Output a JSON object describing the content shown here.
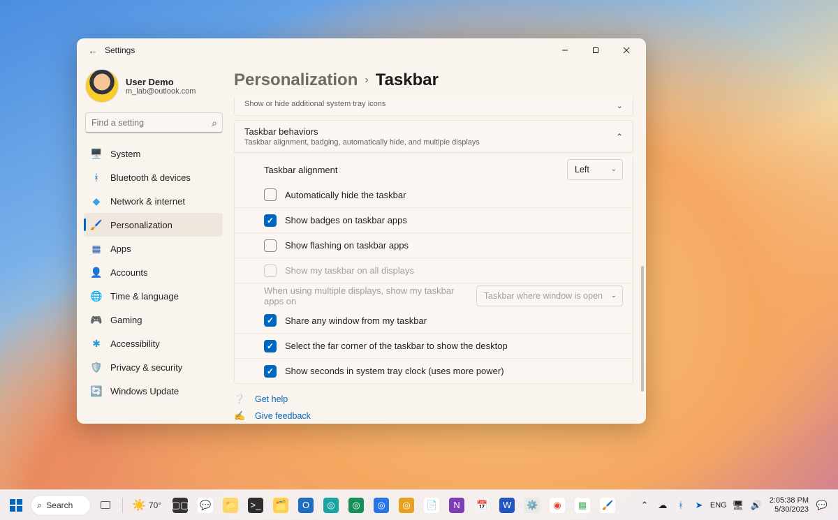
{
  "window": {
    "title": "Settings",
    "back_aria": "Back"
  },
  "user": {
    "name": "User Demo",
    "email": "m_lab@outlook.com"
  },
  "search": {
    "placeholder": "Find a setting"
  },
  "nav": [
    {
      "icon": "🖥️",
      "label": "System"
    },
    {
      "icon": "ᚼ",
      "iconColor": "#0067c0",
      "label": "Bluetooth & devices"
    },
    {
      "icon": "◆",
      "iconColor": "#3aa0e6",
      "label": "Network & internet"
    },
    {
      "icon": "🖌️",
      "label": "Personalization",
      "selected": true
    },
    {
      "icon": "▦",
      "iconColor": "#2a5db0",
      "label": "Apps"
    },
    {
      "icon": "👤",
      "iconColor": "#3fae6d",
      "label": "Accounts"
    },
    {
      "icon": "🌐",
      "iconColor": "#2a9ed6",
      "label": "Time & language"
    },
    {
      "icon": "🎮",
      "label": "Gaming"
    },
    {
      "icon": "✱",
      "iconColor": "#2a9ed6",
      "label": "Accessibility"
    },
    {
      "icon": "🛡️",
      "label": "Privacy & security"
    },
    {
      "icon": "🔄",
      "iconColor": "#2a9ed6",
      "label": "Windows Update"
    }
  ],
  "breadcrumb": {
    "parent": "Personalization",
    "current": "Taskbar"
  },
  "prev_section_sub": "Show or hide additional system tray icons",
  "section": {
    "title": "Taskbar behaviors",
    "subtitle": "Taskbar alignment, badging, automatically hide, and multiple displays"
  },
  "alignment": {
    "label": "Taskbar alignment",
    "value": "Left"
  },
  "options": [
    {
      "label": "Automatically hide the taskbar",
      "checked": false
    },
    {
      "label": "Show badges on taskbar apps",
      "checked": true
    },
    {
      "label": "Show flashing on taskbar apps",
      "checked": false
    },
    {
      "label": "Show my taskbar on all displays",
      "checked": false,
      "disabled": true
    }
  ],
  "multi": {
    "label": "When using multiple displays, show my taskbar apps on",
    "value": "Taskbar where window is open",
    "disabled": true
  },
  "options2": [
    {
      "label": "Share any window from my taskbar",
      "checked": true
    },
    {
      "label": "Select the far corner of the taskbar to show the desktop",
      "checked": true
    },
    {
      "label": "Show seconds in system tray clock (uses more power)",
      "checked": true
    }
  ],
  "help": {
    "get_help": "Get help",
    "give_feedback": "Give feedback"
  },
  "taskbar": {
    "search": "Search",
    "weather": "70°",
    "apps": [
      {
        "name": "task-view",
        "bg": "#333",
        "glyph": "▢▢",
        "color": "#fff"
      },
      {
        "name": "chat",
        "bg": "#fff",
        "glyph": "💬",
        "color": "#6b5ae0"
      },
      {
        "name": "explorer",
        "bg": "#ffd56b",
        "glyph": "📁"
      },
      {
        "name": "terminal",
        "bg": "#2d2d2d",
        "glyph": ">_",
        "color": "#fff"
      },
      {
        "name": "file-explorer",
        "bg": "#ffcf4d",
        "glyph": "🗂️"
      },
      {
        "name": "outlook",
        "bg": "#1f6dc0",
        "glyph": "O",
        "color": "#fff"
      },
      {
        "name": "edge",
        "bg": "#1aa3a3",
        "glyph": "◎",
        "color": "#fff"
      },
      {
        "name": "edge-dev",
        "bg": "#188f58",
        "glyph": "◎",
        "color": "#fff"
      },
      {
        "name": "edge-beta",
        "bg": "#2876e6",
        "glyph": "◎",
        "color": "#fff"
      },
      {
        "name": "edge-canary",
        "bg": "#e6a21f",
        "glyph": "◎",
        "color": "#fff"
      },
      {
        "name": "notepad",
        "bg": "#fff",
        "glyph": "📄"
      },
      {
        "name": "onenote",
        "bg": "#7d3db6",
        "glyph": "N",
        "color": "#fff"
      },
      {
        "name": "calendar",
        "bg": "#f3f3f3",
        "glyph": "📅"
      },
      {
        "name": "word",
        "bg": "#2156c0",
        "glyph": "W",
        "color": "#fff"
      },
      {
        "name": "settings",
        "bg": "#e8e8e8",
        "glyph": "⚙️"
      },
      {
        "name": "chrome",
        "bg": "#fff",
        "glyph": "◉",
        "color": "#e34133"
      },
      {
        "name": "app-grid",
        "bg": "#fff",
        "glyph": "▦",
        "color": "#47b262"
      },
      {
        "name": "paint",
        "bg": "#fff",
        "glyph": "🖌️",
        "color": "#9b5de0"
      }
    ],
    "tray": {
      "lang": "ENG"
    },
    "clock": {
      "time": "2:05:38 PM",
      "date": "5/30/2023"
    }
  }
}
